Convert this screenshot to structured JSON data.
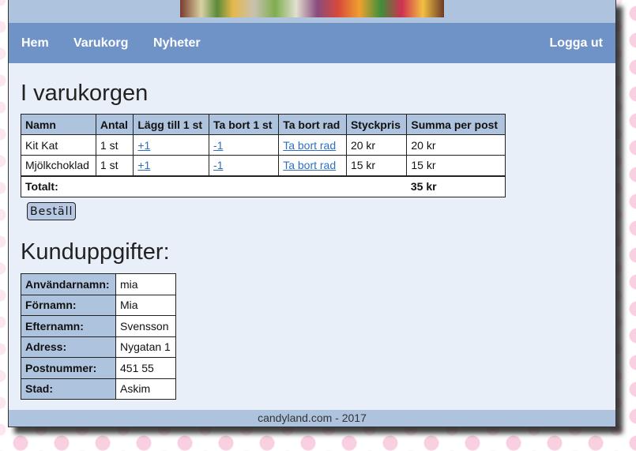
{
  "nav": {
    "items": [
      {
        "label": "Hem"
      },
      {
        "label": "Varukorg"
      },
      {
        "label": "Nyheter"
      }
    ],
    "logout_label": "Logga ut"
  },
  "cart": {
    "heading": "I varukorgen",
    "columns": [
      "Namn",
      "Antal",
      "Lägg till 1 st",
      "Ta bort 1 st",
      "Ta bort rad",
      "Styckpris",
      "Summa per post"
    ],
    "rows": [
      {
        "name": "Kit Kat",
        "qty": "1 st",
        "add": "+1",
        "remove": "-1",
        "remove_row": "Ta bort rad",
        "unit_price": "20 kr",
        "sum": "20 kr"
      },
      {
        "name": "Mjölkchoklad",
        "qty": "1 st",
        "add": "+1",
        "remove": "-1",
        "remove_row": "Ta bort rad",
        "unit_price": "15 kr",
        "sum": "15 kr"
      }
    ],
    "total_label": "Totalt:",
    "total_value": "35 kr",
    "order_button": "Beställ"
  },
  "customer": {
    "heading": "Kunduppgifter:",
    "fields": [
      {
        "label": "Användarnamn:",
        "value": "mia"
      },
      {
        "label": "Förnamn:",
        "value": "Mia"
      },
      {
        "label": "Efternamn:",
        "value": "Svensson"
      },
      {
        "label": "Adress:",
        "value": "Nygatan 1"
      },
      {
        "label": "Postnummer:",
        "value": "451 55"
      },
      {
        "label": "Stad:",
        "value": "Askim"
      }
    ]
  },
  "footer": {
    "text": "candyland.com - 2017"
  }
}
